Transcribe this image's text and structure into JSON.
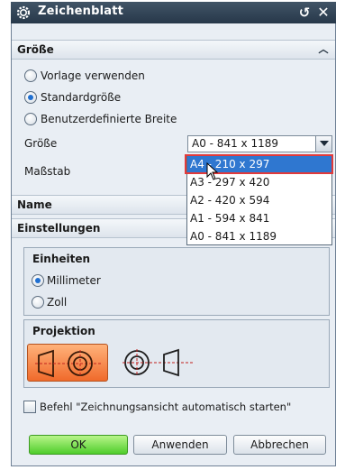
{
  "window": {
    "title": "Zeichenblatt",
    "undo_icon": "undo-icon",
    "close_icon": "close-icon",
    "settings_icon": "gear-icon"
  },
  "groesse_section": {
    "header": "Größe",
    "options": [
      {
        "label": "Vorlage verwenden",
        "selected": false
      },
      {
        "label": "Standardgröße",
        "selected": true
      },
      {
        "label": "Benutzerdefinierte Breite",
        "selected": false
      }
    ],
    "size_label": "Größe",
    "size_value": "A0 - 841 x 1189",
    "scale_label": "Maßstab",
    "dropdown_options": [
      "A4 - 210 x 297",
      "A3 - 297 x 420",
      "A2 - 420 x 594",
      "A1 - 594 x 841",
      "A0 - 841 x 1189"
    ],
    "dropdown_selected": "A4 - 210 x 297"
  },
  "name_section": {
    "header": "Name"
  },
  "einstellungen_section": {
    "header": "Einstellungen",
    "units_title": "Einheiten",
    "units": [
      {
        "label": "Millimeter",
        "selected": true
      },
      {
        "label": "Zoll",
        "selected": false
      }
    ],
    "projection_title": "Projektion",
    "projection_icons": [
      "first-angle-projection-icon",
      "third-angle-projection-icon"
    ]
  },
  "auto_start_checkbox": {
    "label": "Befehl \"Zeichnungsansicht automatisch starten\"",
    "checked": false
  },
  "buttons": {
    "ok": "OK",
    "apply": "Anwenden",
    "cancel": "Abbrechen"
  },
  "colors": {
    "titlebar": "#2f4152",
    "selection": "#2f77d0",
    "highlight_border": "#e23a3a",
    "ok_button": "#4fcd2c",
    "projection_active": "#f06a2b"
  }
}
